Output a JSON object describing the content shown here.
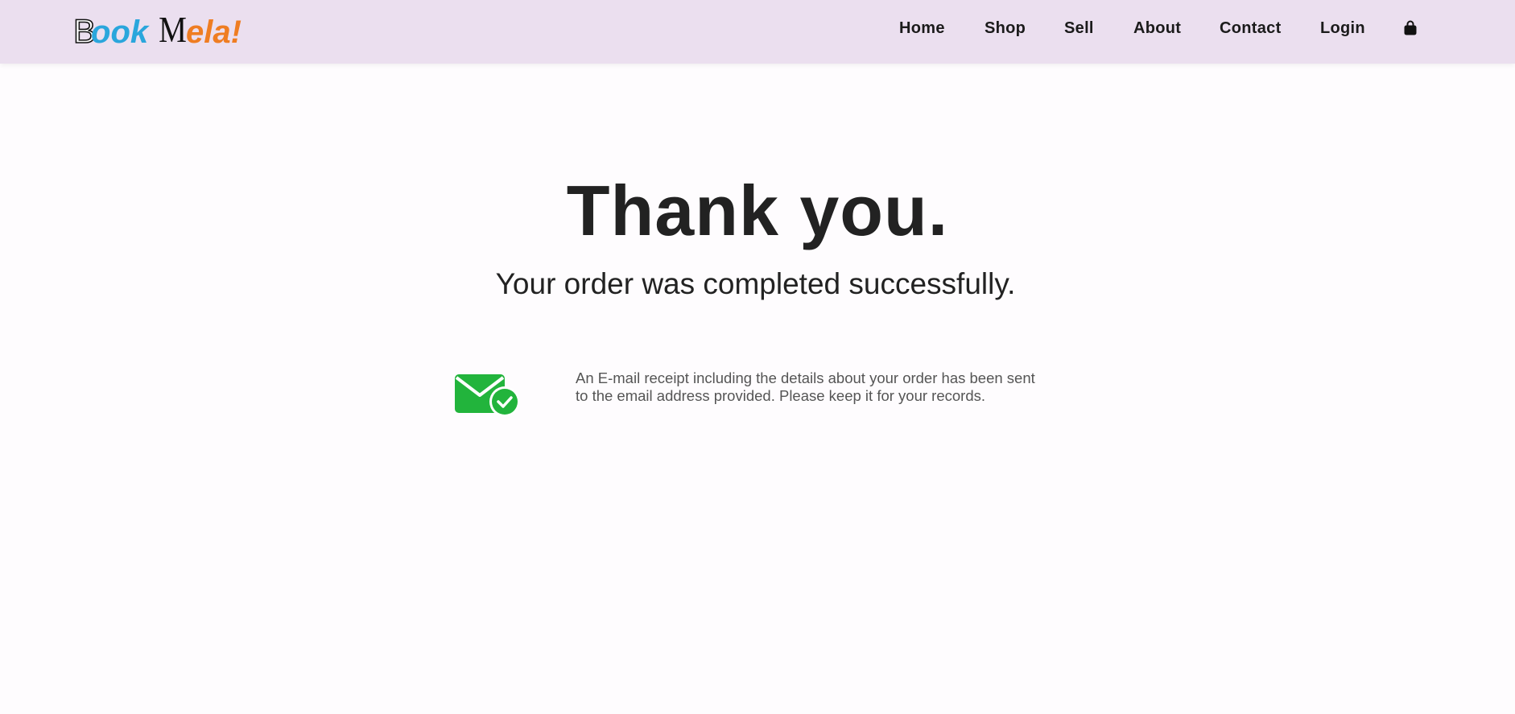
{
  "brand": {
    "logo_b": "B",
    "logo_ook": "ook",
    "logo_m": "M",
    "logo_ela": "ela!",
    "colors": {
      "blue": "#2aa6dc",
      "orange": "#ef7d22",
      "nav_bg": "#ebdfef",
      "success_green": "#22b43c"
    }
  },
  "nav": {
    "items": [
      {
        "label": "Home"
      },
      {
        "label": "Shop"
      },
      {
        "label": "Sell"
      },
      {
        "label": "About"
      },
      {
        "label": "Contact"
      },
      {
        "label": "Login"
      }
    ],
    "cart_icon": "shopping-bag-icon"
  },
  "main": {
    "title": "Thank you.",
    "subtitle": "Your order was completed successfully.",
    "receipt_icon": "envelope-check-icon",
    "receipt_line1": "An E-mail receipt including the details about your order has been sent",
    "receipt_line2": "to the email address provided. Please keep it for your records."
  }
}
